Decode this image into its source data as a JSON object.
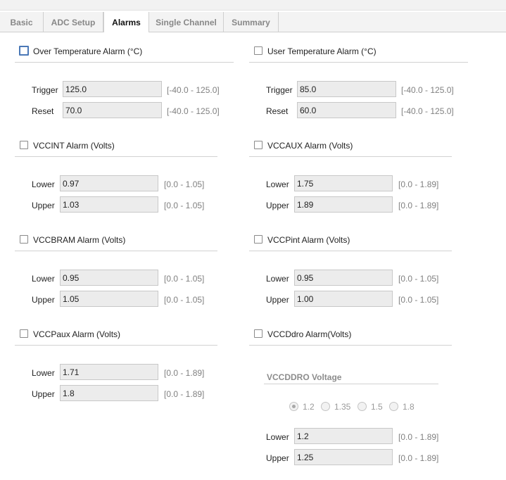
{
  "tabs": [
    "Basic",
    "ADC Setup",
    "Alarms",
    "Single Channel",
    "Summary"
  ],
  "active_tab": "Alarms",
  "over_temp": {
    "title": "Over Temperature Alarm (°C)",
    "checked": false,
    "trigger_label": "Trigger",
    "trigger_value": "125.0",
    "trigger_range": "[-40.0 - 125.0]",
    "reset_label": "Reset",
    "reset_value": "70.0",
    "reset_range": "[-40.0 - 125.0]"
  },
  "user_temp": {
    "title": "User Temperature Alarm (°C)",
    "checked": false,
    "trigger_label": "Trigger",
    "trigger_value": "85.0",
    "trigger_range": "[-40.0 - 125.0]",
    "reset_label": "Reset",
    "reset_value": "60.0",
    "reset_range": "[-40.0 - 125.0]"
  },
  "vccint": {
    "title": "VCCINT Alarm (Volts)",
    "checked": false,
    "lower_label": "Lower",
    "lower_value": "0.97",
    "lower_range": "[0.0 - 1.05]",
    "upper_label": "Upper",
    "upper_value": "1.03",
    "upper_range": "[0.0 - 1.05]"
  },
  "vccaux": {
    "title": "VCCAUX Alarm (Volts)",
    "checked": false,
    "lower_label": "Lower",
    "lower_value": "1.75",
    "lower_range": "[0.0 - 1.89]",
    "upper_label": "Upper",
    "upper_value": "1.89",
    "upper_range": "[0.0 - 1.89]"
  },
  "vccbram": {
    "title": "VCCBRAM Alarm (Volts)",
    "checked": false,
    "lower_label": "Lower",
    "lower_value": "0.95",
    "lower_range": "[0.0 - 1.05]",
    "upper_label": "Upper",
    "upper_value": "1.05",
    "upper_range": "[0.0 - 1.05]"
  },
  "vccpint": {
    "title": "VCCPint Alarm (Volts)",
    "checked": false,
    "lower_label": "Lower",
    "lower_value": "0.95",
    "lower_range": "[0.0 - 1.05]",
    "upper_label": "Upper",
    "upper_value": "1.00",
    "upper_range": "[0.0 - 1.05]"
  },
  "vccpaux": {
    "title": "VCCPaux Alarm (Volts)",
    "checked": false,
    "lower_label": "Lower",
    "lower_value": "1.71",
    "lower_range": "[0.0 - 1.89]",
    "upper_label": "Upper",
    "upper_value": "1.8",
    "upper_range": "[0.0 - 1.89]"
  },
  "vccddro": {
    "title": "VCCDdro Alarm(Volts)",
    "checked": false,
    "voltage_title": "VCCDDRO Voltage",
    "voltage_options": [
      "1.2",
      "1.35",
      "1.5",
      "1.8"
    ],
    "voltage_selected": "1.2",
    "lower_label": "Lower",
    "lower_value": "1.2",
    "lower_range": "[0.0 - 1.89]",
    "upper_label": "Upper",
    "upper_value": "1.25",
    "upper_range": "[0.0 - 1.89]"
  }
}
